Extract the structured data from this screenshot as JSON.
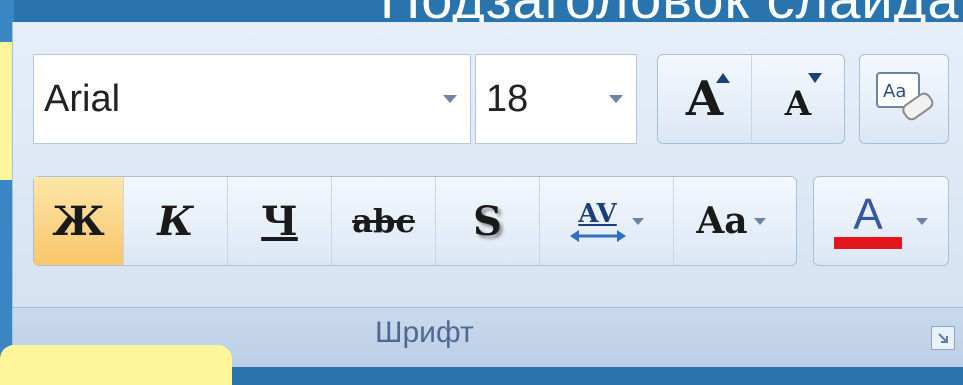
{
  "slide": {
    "title_fragment": "Подзаголовок слайда"
  },
  "font_group": {
    "label": "Шрифт",
    "font_name": "Arial",
    "font_size": "18",
    "grow_font_glyph": "A",
    "shrink_font_glyph": "A",
    "clear_format_glyph": "Aa",
    "buttons": [
      {
        "name": "bold",
        "glyph": "Ж",
        "active": true
      },
      {
        "name": "italic",
        "glyph": "К",
        "active": false
      },
      {
        "name": "underline",
        "glyph": "Ч",
        "active": false
      },
      {
        "name": "strikethrough",
        "glyph": "abc",
        "active": false
      },
      {
        "name": "shadow",
        "glyph": "S",
        "active": false
      }
    ],
    "spacing_glyph": "AV",
    "case_glyph": "Aa",
    "font_color_glyph": "A"
  },
  "colors": {
    "font_color_swatch": "#e3161b",
    "active_button": "#f9c66b",
    "slide_background": "#2a74ad",
    "note": "#fff59a"
  },
  "icons": [
    "dropdown-arrow-icon",
    "grow-font-icon",
    "shrink-font-icon",
    "eraser-icon",
    "dialog-launcher-icon"
  ]
}
